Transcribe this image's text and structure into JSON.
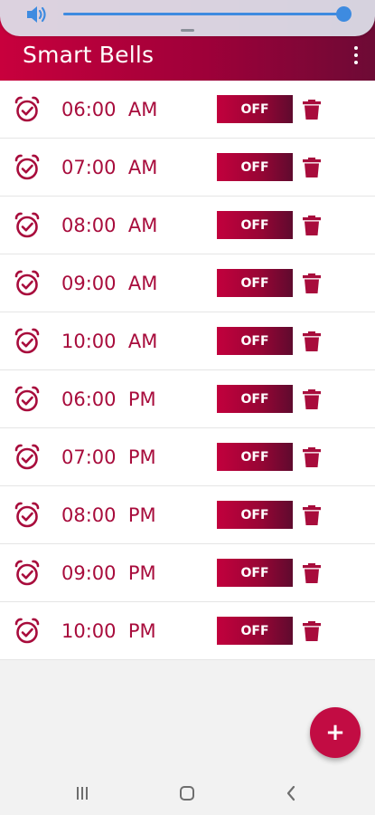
{
  "app": {
    "title": "Smart Bells",
    "accent_color": "#c2003d",
    "overflow_menu_icon": "more-vert-icon"
  },
  "volume": {
    "icon": "speaker-volume-icon",
    "level": 1.0
  },
  "alarms": [
    {
      "time": "06:00  AM",
      "toggle_label": "OFF"
    },
    {
      "time": "07:00  AM",
      "toggle_label": "OFF"
    },
    {
      "time": "08:00  AM",
      "toggle_label": "OFF"
    },
    {
      "time": "09:00  AM",
      "toggle_label": "OFF"
    },
    {
      "time": "10:00  AM",
      "toggle_label": "OFF"
    },
    {
      "time": "06:00  PM",
      "toggle_label": "OFF"
    },
    {
      "time": "07:00  PM",
      "toggle_label": "OFF"
    },
    {
      "time": "08:00  PM",
      "toggle_label": "OFF"
    },
    {
      "time": "09:00  PM",
      "toggle_label": "OFF"
    },
    {
      "time": "10:00  PM",
      "toggle_label": "OFF"
    }
  ],
  "fab": {
    "label": "+"
  },
  "navbar": {
    "recent_icon": "recent-apps-icon",
    "home_icon": "home-icon",
    "back_icon": "back-icon"
  }
}
